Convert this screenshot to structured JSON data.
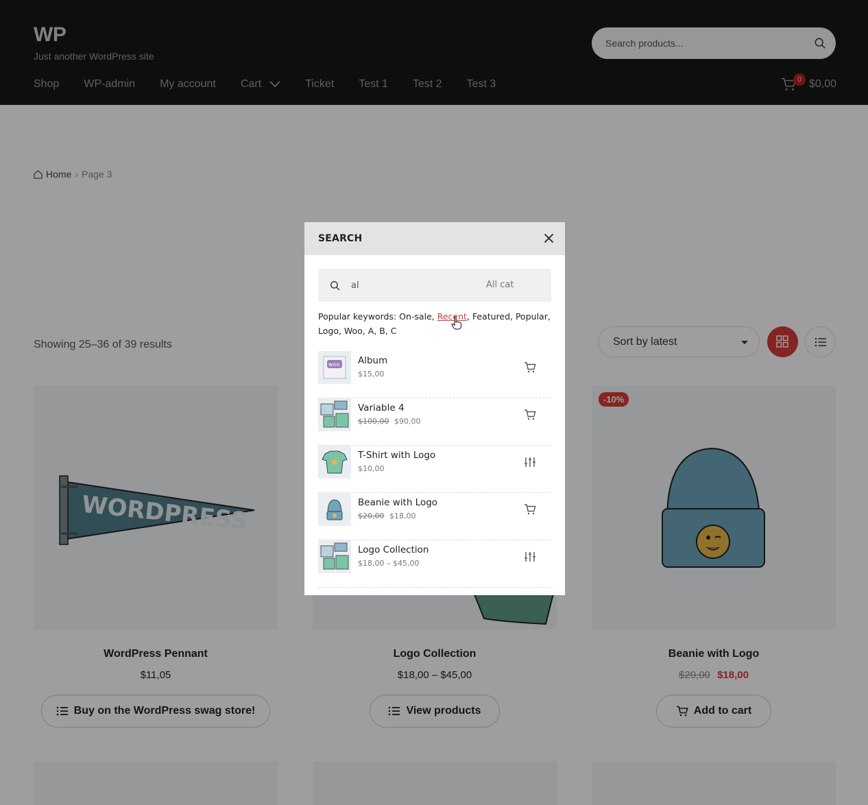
{
  "header": {
    "logo": "WP",
    "tagline": "Just another WordPress site",
    "search_placeholder": "Search products...",
    "nav": [
      "Shop",
      "WP-admin",
      "My account",
      "Cart",
      "Ticket",
      "Test 1",
      "Test 2",
      "Test 3"
    ],
    "cart_count": "0",
    "cart_total": "$0,00"
  },
  "breadcrumb": {
    "home": "Home",
    "current": "Page 3"
  },
  "toolbar": {
    "result_count": "Showing 25–36 of 39 results",
    "sort_label": "Sort by latest"
  },
  "products": [
    {
      "title": "WordPress Pennant",
      "price": "$11,05",
      "button": "Buy on the WordPress swag store!"
    },
    {
      "title": "Logo Collection",
      "price": "$18,00 – $45,00",
      "button": "View products"
    },
    {
      "title": "Beanie with Logo",
      "regular_price": "$20,00",
      "sale_price": "$18,00",
      "button": "Add to cart",
      "badge": "-10%"
    }
  ],
  "modal": {
    "title": "SEARCH",
    "query": "al",
    "category": "All cat",
    "keywords_prefix": "Popular keywords: On-sale, ",
    "keywords_link": "Recent",
    "keywords_suffix": ", Featured, Popular, Logo, Woo, A, B, C",
    "results": [
      {
        "name": "Album",
        "price": "$15,00",
        "action": "cart-icon"
      },
      {
        "name": "Variable 4",
        "regular_price": "$100,00",
        "price": "$90,00",
        "action": "cart-icon"
      },
      {
        "name": "T-Shirt with Logo",
        "price": "$10,00",
        "action": "options-icon"
      },
      {
        "name": "Beanie with Logo",
        "regular_price": "$20,00",
        "price": "$18,00",
        "action": "cart-icon"
      },
      {
        "name": "Logo Collection",
        "price": "$18,00 – $45,00",
        "action": "options-icon"
      }
    ]
  },
  "colors": {
    "accent": "#d93a3a",
    "header_bg": "#171717"
  }
}
